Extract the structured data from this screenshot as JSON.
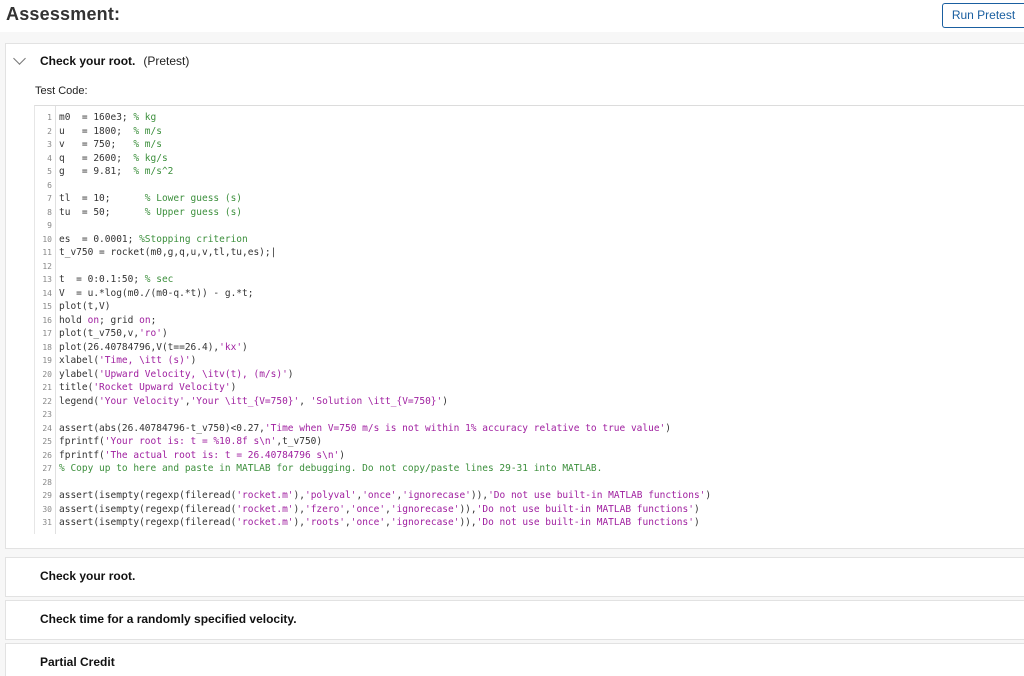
{
  "header": {
    "title": "Assessment:",
    "run_button": "Run Pretest"
  },
  "panels": [
    {
      "title": "Check your root.",
      "subtitle": "(Pretest)",
      "test_code_label": "Test Code:"
    },
    {
      "title": "Check your root."
    },
    {
      "title": "Check time for a randomly specified velocity."
    },
    {
      "title": "Partial Credit"
    }
  ],
  "code_lines": [
    {
      "n": "1",
      "segs": [
        {
          "t": "m0  = 160e3; "
        },
        {
          "t": "% kg",
          "c": "cm"
        }
      ]
    },
    {
      "n": "2",
      "segs": [
        {
          "t": "u   = 1800;  "
        },
        {
          "t": "% m/s",
          "c": "cm"
        }
      ]
    },
    {
      "n": "3",
      "segs": [
        {
          "t": "v   = 750;   "
        },
        {
          "t": "% m/s",
          "c": "cm"
        }
      ]
    },
    {
      "n": "4",
      "segs": [
        {
          "t": "q   = 2600;  "
        },
        {
          "t": "% kg/s",
          "c": "cm"
        }
      ]
    },
    {
      "n": "5",
      "segs": [
        {
          "t": "g   = 9.81;  "
        },
        {
          "t": "% m/s^2",
          "c": "cm"
        }
      ]
    },
    {
      "n": "6",
      "segs": []
    },
    {
      "n": "7",
      "segs": [
        {
          "t": "tl  = 10;      "
        },
        {
          "t": "% Lower guess (s)",
          "c": "cm"
        }
      ]
    },
    {
      "n": "8",
      "segs": [
        {
          "t": "tu  = 50;      "
        },
        {
          "t": "% Upper guess (s)",
          "c": "cm"
        }
      ]
    },
    {
      "n": "9",
      "segs": []
    },
    {
      "n": "10",
      "segs": [
        {
          "t": "es  = 0.0001; "
        },
        {
          "t": "%Stopping criterion",
          "c": "cm"
        }
      ]
    },
    {
      "n": "11",
      "segs": [
        {
          "t": "t_v750 = rocket(m0,g,q,u,v,tl,tu,es);|"
        }
      ]
    },
    {
      "n": "12",
      "segs": []
    },
    {
      "n": "13",
      "segs": [
        {
          "t": "t  = 0:0.1:50; "
        },
        {
          "t": "% sec",
          "c": "cm"
        }
      ]
    },
    {
      "n": "14",
      "segs": [
        {
          "t": "V  = u.*log(m0./(m0-q.*t)) - g.*t;"
        }
      ]
    },
    {
      "n": "15",
      "segs": [
        {
          "t": "plot(t,V)"
        }
      ]
    },
    {
      "n": "16",
      "segs": [
        {
          "t": "hold "
        },
        {
          "t": "on",
          "c": "st"
        },
        {
          "t": "; grid "
        },
        {
          "t": "on",
          "c": "st"
        },
        {
          "t": ";"
        }
      ]
    },
    {
      "n": "17",
      "segs": [
        {
          "t": "plot(t_v750,v,"
        },
        {
          "t": "'ro'",
          "c": "st"
        },
        {
          "t": ")"
        }
      ]
    },
    {
      "n": "18",
      "segs": [
        {
          "t": "plot(26.40784796,V(t==26.4),"
        },
        {
          "t": "'kx'",
          "c": "st"
        },
        {
          "t": ")"
        }
      ]
    },
    {
      "n": "19",
      "segs": [
        {
          "t": "xlabel("
        },
        {
          "t": "'Time, \\itt (s)'",
          "c": "st"
        },
        {
          "t": ")"
        }
      ]
    },
    {
      "n": "20",
      "segs": [
        {
          "t": "ylabel("
        },
        {
          "t": "'Upward Velocity, \\itv(t), (m/s)'",
          "c": "st"
        },
        {
          "t": ")"
        }
      ]
    },
    {
      "n": "21",
      "segs": [
        {
          "t": "title("
        },
        {
          "t": "'Rocket Upward Velocity'",
          "c": "st"
        },
        {
          "t": ")"
        }
      ]
    },
    {
      "n": "22",
      "segs": [
        {
          "t": "legend("
        },
        {
          "t": "'Your Velocity'",
          "c": "st"
        },
        {
          "t": ","
        },
        {
          "t": "'Your \\itt_{V=750}'",
          "c": "st"
        },
        {
          "t": ", "
        },
        {
          "t": "'Solution \\itt_{V=750}'",
          "c": "st"
        },
        {
          "t": ")"
        }
      ]
    },
    {
      "n": "23",
      "segs": []
    },
    {
      "n": "24",
      "segs": [
        {
          "t": "assert(abs(26.40784796-t_v750)<0.27,"
        },
        {
          "t": "'Time when V=750 m/s is not within 1% accuracy relative to true value'",
          "c": "st"
        },
        {
          "t": ")"
        }
      ]
    },
    {
      "n": "25",
      "segs": [
        {
          "t": "fprintf("
        },
        {
          "t": "'Your root is: t = %10.8f s\\n'",
          "c": "st"
        },
        {
          "t": ",t_v750)"
        }
      ]
    },
    {
      "n": "26",
      "segs": [
        {
          "t": "fprintf("
        },
        {
          "t": "'The actual root is: t = 26.40784796 s\\n'",
          "c": "st"
        },
        {
          "t": ")"
        }
      ]
    },
    {
      "n": "27",
      "segs": [
        {
          "t": "% Copy up to here and paste in MATLAB for debugging. Do not copy/paste lines 29-31 into MATLAB.",
          "c": "cm"
        }
      ]
    },
    {
      "n": "28",
      "segs": []
    },
    {
      "n": "29",
      "segs": [
        {
          "t": "assert(isempty(regexp(fileread("
        },
        {
          "t": "'rocket.m'",
          "c": "st"
        },
        {
          "t": "),"
        },
        {
          "t": "'polyval'",
          "c": "st"
        },
        {
          "t": ","
        },
        {
          "t": "'once'",
          "c": "st"
        },
        {
          "t": ","
        },
        {
          "t": "'ignorecase'",
          "c": "st"
        },
        {
          "t": ")),"
        },
        {
          "t": "'Do not use built-in MATLAB functions'",
          "c": "st"
        },
        {
          "t": ")"
        }
      ]
    },
    {
      "n": "30",
      "segs": [
        {
          "t": "assert(isempty(regexp(fileread("
        },
        {
          "t": "'rocket.m'",
          "c": "st"
        },
        {
          "t": "),"
        },
        {
          "t": "'fzero'",
          "c": "st"
        },
        {
          "t": ","
        },
        {
          "t": "'once'",
          "c": "st"
        },
        {
          "t": ","
        },
        {
          "t": "'ignorecase'",
          "c": "st"
        },
        {
          "t": ")),"
        },
        {
          "t": "'Do not use built-in MATLAB functions'",
          "c": "st"
        },
        {
          "t": ")"
        }
      ]
    },
    {
      "n": "31",
      "segs": [
        {
          "t": "assert(isempty(regexp(fileread("
        },
        {
          "t": "'rocket.m'",
          "c": "st"
        },
        {
          "t": "),"
        },
        {
          "t": "'roots'",
          "c": "st"
        },
        {
          "t": ","
        },
        {
          "t": "'once'",
          "c": "st"
        },
        {
          "t": ","
        },
        {
          "t": "'ignorecase'",
          "c": "st"
        },
        {
          "t": ")),"
        },
        {
          "t": "'Do not use built-in MATLAB functions'",
          "c": "st"
        },
        {
          "t": ")"
        }
      ]
    }
  ]
}
